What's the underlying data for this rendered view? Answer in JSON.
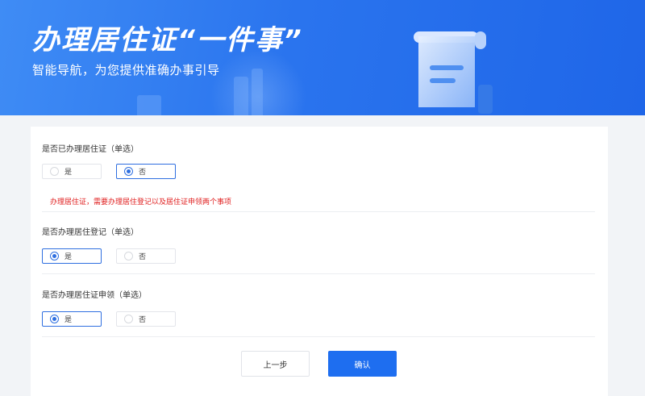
{
  "header": {
    "title": "办理居住证“一件事”",
    "subtitle": "智能导航，为您提供准确办事引导"
  },
  "questions": [
    {
      "label": "是否已办理居住证（单选）",
      "options": [
        {
          "label": "是",
          "checked": false
        },
        {
          "label": "否",
          "checked": true
        }
      ],
      "hint": "办理居住证，需要办理居住登记以及居住证申领两个事项"
    },
    {
      "label": "是否办理居住登记（单选）",
      "options": [
        {
          "label": "是",
          "checked": true
        },
        {
          "label": "否",
          "checked": false
        }
      ]
    },
    {
      "label": "是否办理居住证申领（单选）",
      "options": [
        {
          "label": "是",
          "checked": true
        },
        {
          "label": "否",
          "checked": false
        }
      ]
    }
  ],
  "actions": {
    "prev_label": "上一步",
    "confirm_label": "确认"
  },
  "colors": {
    "accent": "#1e6ef0",
    "hint": "#e02020",
    "banner": "#2a74ee"
  }
}
